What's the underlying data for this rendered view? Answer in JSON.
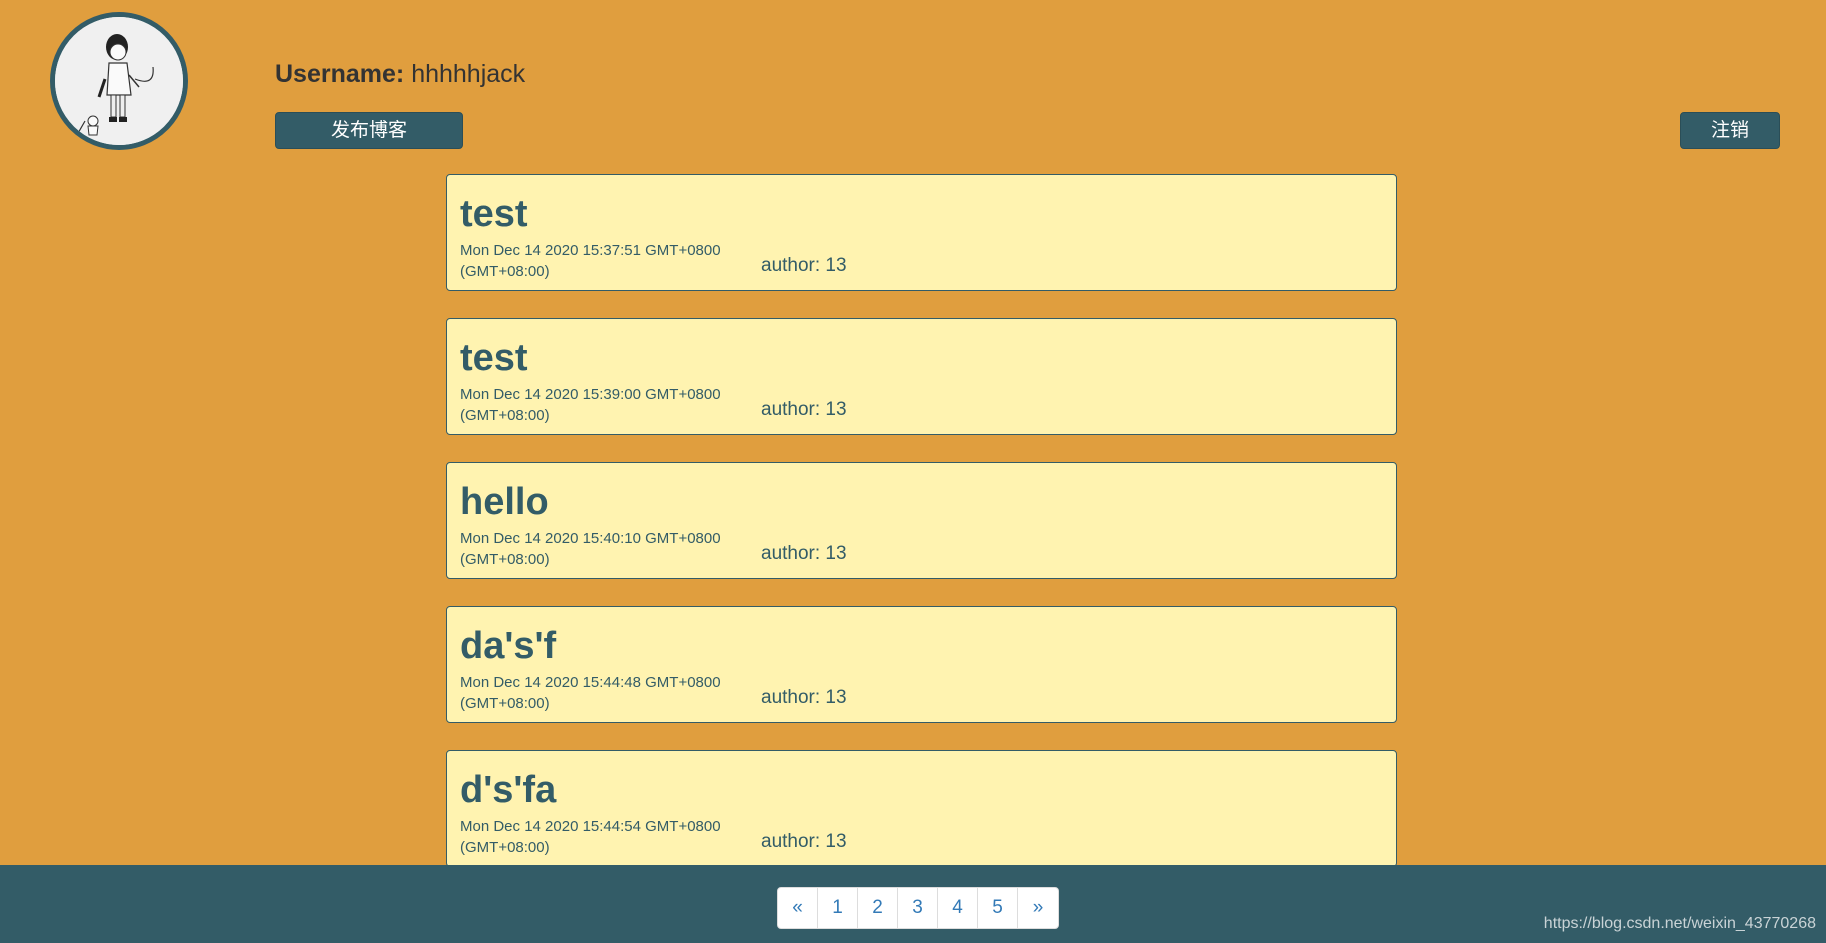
{
  "user": {
    "username_label": "Username:",
    "username_value": "hhhhhjack"
  },
  "actions": {
    "publish_label": "发布博客",
    "logout_label": "注销"
  },
  "posts": [
    {
      "title": "test",
      "date": "Mon Dec 14 2020 15:37:51 GMT+0800 (GMT+08:00)",
      "author": "author: 13"
    },
    {
      "title": "test",
      "date": "Mon Dec 14 2020 15:39:00 GMT+0800 (GMT+08:00)",
      "author": "author: 13"
    },
    {
      "title": "hello",
      "date": "Mon Dec 14 2020 15:40:10 GMT+0800 (GMT+08:00)",
      "author": "author: 13"
    },
    {
      "title": "da's'f",
      "date": "Mon Dec 14 2020 15:44:48 GMT+0800 (GMT+08:00)",
      "author": "author: 13"
    },
    {
      "title": "d's'fa",
      "date": "Mon Dec 14 2020 15:44:54 GMT+0800 (GMT+08:00)",
      "author": "author: 13"
    }
  ],
  "pagination": {
    "prev": "«",
    "pages": [
      "1",
      "2",
      "3",
      "4",
      "5"
    ],
    "next": "»"
  },
  "watermark": "https://blog.csdn.net/weixin_43770268",
  "colors": {
    "background": "#e09e3e",
    "accent": "#335c67",
    "card": "#fff3b0",
    "link": "#337ab7"
  }
}
